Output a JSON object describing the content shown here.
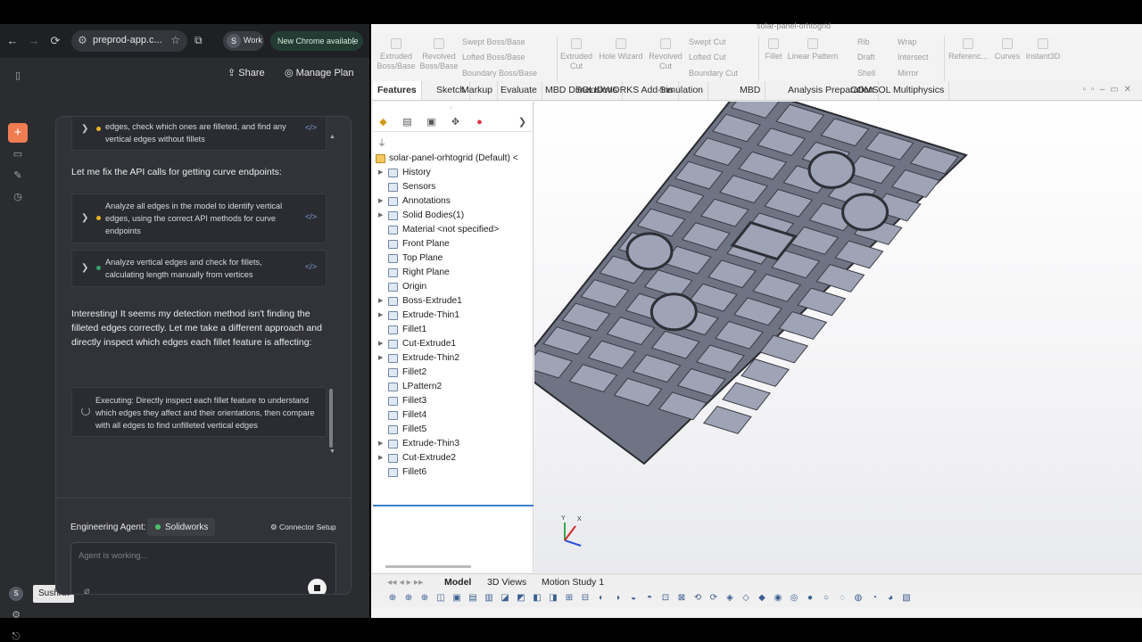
{
  "browser": {
    "url": "preprod-app.c...",
    "profile_initial": "S",
    "profile_name": "Work",
    "update_label": "New Chrome available"
  },
  "header": {
    "share_label": "Share",
    "plan_label": "Manage Plan"
  },
  "chat": {
    "card1_text": "edges, check which ones are filleted, and find any vertical edges without fillets",
    "msg1": "Let me fix the API calls for getting curve endpoints:",
    "card2_text": "Analyze all edges in the model to identify vertical edges, using the correct API methods for curve endpoints",
    "card3_text": "Analyze vertical edges and check for fillets, calculating length manually from vertices",
    "msg2": "Interesting! It seems my detection method isn't finding the filleted edges correctly. Let me take a different approach and directly inspect which edges each fillet feature is affecting:",
    "exec_text": "Executing: Directly inspect each fillet feature to understand which edges they affect and their orientations, then compare with all edges to find unfilleted vertical edges",
    "code_glyph": "</>",
    "status_colors": {
      "running": "#e6b422",
      "done": "#2fa36b"
    }
  },
  "composer": {
    "agent_label": "Engineering Agent:",
    "agent_name": "Solidworks",
    "connector_label": "Connector Setup",
    "placeholder": "Agent is working..."
  },
  "sidebar": {
    "avatar_initial": "S",
    "tooltip": "Sushrut"
  },
  "solidworks": {
    "title": "solar-panel-orhtogrid",
    "ribbon": {
      "extruded_boss": "Extruded Boss/Base",
      "revolved_boss": "Revolved Boss/Base",
      "swept_boss": "Swept Boss/Base",
      "lofted_boss": "Lofted Boss/Base",
      "boundary_boss": "Boundary Boss/Base",
      "extruded_cut": "Extruded Cut",
      "hole_wizard": "Hole Wizard",
      "revolved_cut": "Revolved Cut",
      "swept_cut": "Swept Cut",
      "lofted_cut": "Lofted Cut",
      "boundary_cut": "Boundary Cut",
      "fillet": "Fillet",
      "linear_pattern": "Linear Pattern",
      "rib": "Rib",
      "draft": "Draft",
      "shell": "Shell",
      "wrap": "Wrap",
      "intersect": "Intersect",
      "mirror": "Mirror",
      "reference": "Referenc...",
      "curves": "Curves",
      "instant3d": "Instant3D"
    },
    "tabs": [
      "Features",
      "Sketch",
      "Markup",
      "Evaluate",
      "MBD Dimensions",
      "SOLIDWORKS Add-Ins",
      "Simulation",
      "MBD",
      "Analysis Preparation",
      "COMSOL Multiphysics"
    ],
    "tree_root": "solar-panel-orhtogrid  (Default) <",
    "tree": [
      {
        "label": "History",
        "arrow": true
      },
      {
        "label": "Sensors",
        "arrow": false
      },
      {
        "label": "Annotations",
        "arrow": true
      },
      {
        "label": "Solid Bodies(1)",
        "arrow": true
      },
      {
        "label": "Material <not specified>",
        "arrow": false
      },
      {
        "label": "Front Plane",
        "arrow": false
      },
      {
        "label": "Top Plane",
        "arrow": false
      },
      {
        "label": "Right Plane",
        "arrow": false
      },
      {
        "label": "Origin",
        "arrow": false
      },
      {
        "label": "Boss-Extrude1",
        "arrow": true
      },
      {
        "label": "Extrude-Thin1",
        "arrow": true
      },
      {
        "label": "Fillet1",
        "arrow": false
      },
      {
        "label": "Cut-Extrude1",
        "arrow": true
      },
      {
        "label": "Extrude-Thin2",
        "arrow": true
      },
      {
        "label": "Fillet2",
        "arrow": false
      },
      {
        "label": "LPattern2",
        "arrow": false
      },
      {
        "label": "Fillet3",
        "arrow": false
      },
      {
        "label": "Fillet4",
        "arrow": false
      },
      {
        "label": "Fillet5",
        "arrow": false
      },
      {
        "label": "Extrude-Thin3",
        "arrow": true
      },
      {
        "label": "Cut-Extrude2",
        "arrow": true
      },
      {
        "label": "Fillet6",
        "arrow": false
      }
    ],
    "bottom_tabs": {
      "model": "Model",
      "views3d": "3D Views",
      "motion": "Motion Study 1"
    }
  }
}
